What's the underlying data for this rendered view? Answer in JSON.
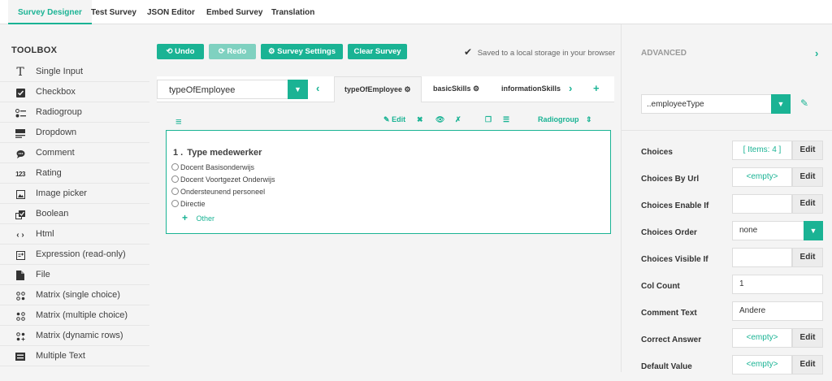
{
  "top_tabs": [
    "Survey Designer",
    "Test Survey",
    "JSON Editor",
    "Embed Survey",
    "Translation"
  ],
  "toolbox": {
    "title": "TOOLBOX",
    "items": [
      {
        "label": "Single Input",
        "icon": "text-input-icon"
      },
      {
        "label": "Checkbox",
        "icon": "checkbox-icon"
      },
      {
        "label": "Radiogroup",
        "icon": "radiogroup-icon"
      },
      {
        "label": "Dropdown",
        "icon": "dropdown-icon"
      },
      {
        "label": "Comment",
        "icon": "comment-icon"
      },
      {
        "label": "Rating",
        "icon": "rating-icon"
      },
      {
        "label": "Image picker",
        "icon": "image-picker-icon"
      },
      {
        "label": "Boolean",
        "icon": "boolean-icon"
      },
      {
        "label": "Html",
        "icon": "html-icon"
      },
      {
        "label": "Expression (read-only)",
        "icon": "expression-icon"
      },
      {
        "label": "File",
        "icon": "file-icon"
      },
      {
        "label": "Matrix (single choice)",
        "icon": "matrix-single-icon"
      },
      {
        "label": "Matrix (multiple choice)",
        "icon": "matrix-multiple-icon"
      },
      {
        "label": "Matrix (dynamic rows)",
        "icon": "matrix-dynamic-icon"
      },
      {
        "label": "Multiple Text",
        "icon": "multiple-text-icon"
      }
    ]
  },
  "actions": {
    "undo": "Undo",
    "redo": "Redo",
    "survey_settings": "Survey Settings",
    "clear_survey": "Clear Survey",
    "saved_status": "Saved to a local storage in your browser"
  },
  "pages": {
    "selected": "typeOfEmployee",
    "tabs": [
      "typeOfEmployee",
      "basicSkills",
      "informationSkills"
    ]
  },
  "question_toolbar": {
    "edit": "Edit",
    "type": "Radiogroup"
  },
  "question": {
    "number": "1 .",
    "title": "Type medewerker",
    "choices": [
      "Docent Basisonderwijs",
      "Docent Voortgezet Onderwijs",
      "Ondersteunend personeel",
      "Directie"
    ],
    "other_label": "Other"
  },
  "advanced": {
    "title": "ADVANCED",
    "object_selector": "..employeeType",
    "properties": [
      {
        "label": "Choices",
        "value": "[ Items: 4 ]",
        "control": "edit"
      },
      {
        "label": "Choices By Url",
        "value": "<empty>",
        "control": "edit"
      },
      {
        "label": "Choices Enable If",
        "value": "",
        "control": "edit"
      },
      {
        "label": "Choices Order",
        "value": "none",
        "control": "dropdown"
      },
      {
        "label": "Choices Visible If",
        "value": "",
        "control": "edit"
      },
      {
        "label": "Col Count",
        "value": "1",
        "control": "input"
      },
      {
        "label": "Comment Text",
        "value": "Andere",
        "control": "input"
      },
      {
        "label": "Correct Answer",
        "value": "<empty>",
        "control": "edit"
      },
      {
        "label": "Default Value",
        "value": "<empty>",
        "control": "edit"
      }
    ],
    "edit_label": "Edit"
  },
  "colors": {
    "accent": "#1ab394",
    "background": "#f4f4f4"
  }
}
